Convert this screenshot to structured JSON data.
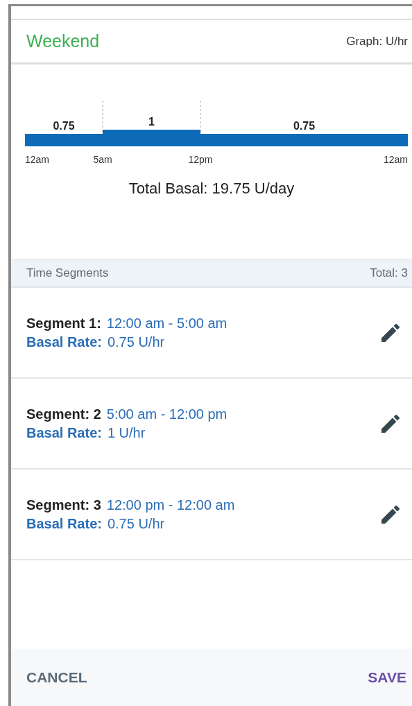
{
  "header": {
    "title": "Weekend",
    "graph_unit": "Graph: U/hr"
  },
  "graph": {
    "bars": [
      {
        "label": "0.75"
      },
      {
        "label": "1"
      },
      {
        "label": "0.75"
      }
    ],
    "ticks": [
      "12am",
      "5am",
      "12pm",
      "12am"
    ]
  },
  "total_basal": "Total Basal: 19.75 U/day",
  "section": {
    "title": "Time Segments",
    "total": "Total: 3"
  },
  "segments": [
    {
      "label": "Segment 1:",
      "time": "12:00 am - 5:00 am",
      "rate_label": "Basal Rate:",
      "rate": "0.75 U/hr"
    },
    {
      "label": "Segment: 2",
      "time": "5:00 am - 12:00 pm",
      "rate_label": "Basal Rate:",
      "rate": "1 U/hr"
    },
    {
      "label": "Segment: 3",
      "time": "12:00 pm - 12:00 am",
      "rate_label": "Basal Rate:",
      "rate": "0.75 U/hr"
    }
  ],
  "buttons": [
    {
      "label": "CANCEL",
      "kind": "secondary"
    },
    {
      "label": "SAVE",
      "kind": "primary"
    }
  ]
}
